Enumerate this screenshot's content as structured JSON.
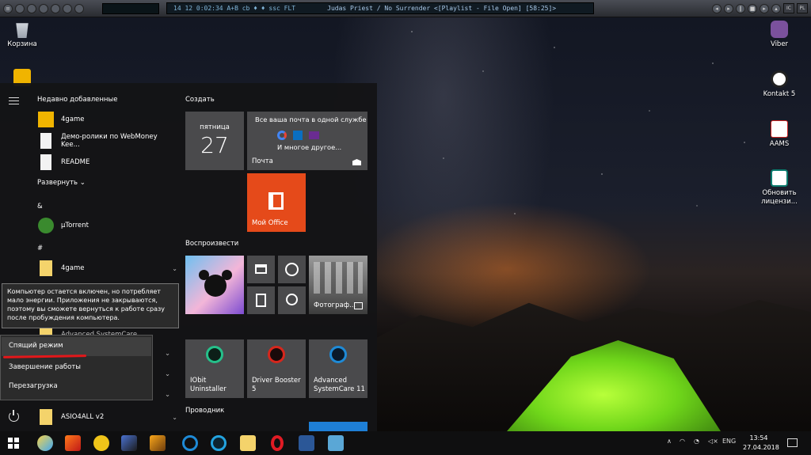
{
  "player": {
    "lcd_left": "14   12   0:02:34   A+B   cb   ♦  ♦   ssc  FLT",
    "title": "Judas Priest / No Surrender   <[Playlist - File Open]   [58:25]>",
    "right_buttons": [
      "IC",
      "PL"
    ]
  },
  "desktop": {
    "recycle": "Корзина",
    "viber": "Viber",
    "kontakt": "Kontakt 5",
    "aams": "AAMS",
    "renew": "Обновить лицензи..."
  },
  "start": {
    "recent_header": "Недавно добавленные",
    "recent": [
      "4game",
      "Демо-ролики по WebMoney Kee...",
      "README"
    ],
    "expand": "Развернуть",
    "expand_chev": "⌄",
    "amp": "&",
    "utorrent": "µTorrent",
    "hash": "#",
    "folder_4game": "4game",
    "partial_app": "Advanced SystemCare",
    "asio": "ASIO4ALL v2",
    "chev": "⌄"
  },
  "tiles": {
    "create_header": "Создать",
    "calendar_day": "пятница",
    "calendar_date": "27",
    "mail_title": "Все ваша почта в одной службе",
    "mail_more": "И многое другое...",
    "mail_label": "Почта",
    "office_label": "Мой Office",
    "play_header": "Воспроизвести",
    "photos_label": "Фотограф...",
    "iobit": "IObit Uninstaller",
    "driver_booster": "Driver Booster 5",
    "asc": "Advanced SystemCare 11",
    "explorer_header": "Проводник"
  },
  "tooltip": "Компьютер остается включен, но потребляет мало энергии. Приложения не закрываются, поэтому вы сможете вернуться к работе сразу после пробуждения компьютера.",
  "power_menu": {
    "sleep": "Спящий режим",
    "shutdown": "Завершение работы",
    "restart": "Перезагрузка"
  },
  "taskbar": {
    "tray_chevron": "∧",
    "lang": "ENG",
    "time": "13:54",
    "date": "27.04.2018"
  }
}
